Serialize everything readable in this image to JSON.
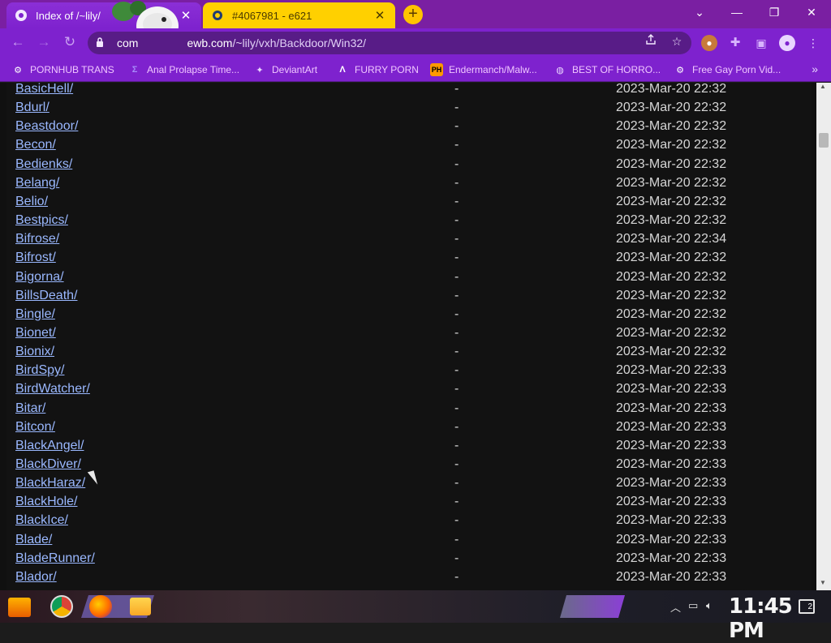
{
  "tabs": [
    {
      "title": "Index of /~lily/",
      "favicon": "app-icon",
      "active": true
    },
    {
      "title": "#4067981 - e621",
      "favicon": "e621-icon",
      "active": false
    }
  ],
  "close_glyph": "✕",
  "new_tab_glyph": "+",
  "window": {
    "minimize": "—",
    "maximize": "❐",
    "close": "✕",
    "dropdown": "⌄"
  },
  "nav": {
    "back": "←",
    "forward": "→",
    "reload": "↻"
  },
  "address": {
    "host_prefix": "com",
    "host_rest": "ewb.com",
    "path": "/~lily/vxh/Backdoor/Win32/"
  },
  "bookmarks": [
    {
      "label": "PORNHUB TRANS",
      "icon": "app-icon",
      "color": "#f0c6ff"
    },
    {
      "label": "Anal Prolapse Time...",
      "icon": "sigma-icon",
      "color": "#e5b0ff"
    },
    {
      "label": "DeviantArt",
      "icon": "da-icon",
      "color": "#e5b0ff"
    },
    {
      "label": "FURRY PORN",
      "icon": "lambda-icon",
      "color": "#e5b0ff"
    },
    {
      "label": "Endermanch/Malw...",
      "icon": "ph-icon",
      "color": "#e5b0ff"
    },
    {
      "label": "BEST OF HORRO...",
      "icon": "globe-icon",
      "color": "#e5b0ff"
    },
    {
      "label": "Free Gay Porn Vid...",
      "icon": "app-icon",
      "color": "#e5b0ff"
    }
  ],
  "bookmarks_more": "»",
  "listing": [
    {
      "name": "BasicHell/",
      "size": "-",
      "date": "2023-Mar-20 22:32"
    },
    {
      "name": "Bdurl/",
      "size": "-",
      "date": "2023-Mar-20 22:32"
    },
    {
      "name": "Beastdoor/",
      "size": "-",
      "date": "2023-Mar-20 22:32"
    },
    {
      "name": "Becon/",
      "size": "-",
      "date": "2023-Mar-20 22:32"
    },
    {
      "name": "Bedienks/",
      "size": "-",
      "date": "2023-Mar-20 22:32"
    },
    {
      "name": "Belang/",
      "size": "-",
      "date": "2023-Mar-20 22:32"
    },
    {
      "name": "Belio/",
      "size": "-",
      "date": "2023-Mar-20 22:32"
    },
    {
      "name": "Bestpics/",
      "size": "-",
      "date": "2023-Mar-20 22:32"
    },
    {
      "name": "Bifrose/",
      "size": "-",
      "date": "2023-Mar-20 22:34"
    },
    {
      "name": "Bifrost/",
      "size": "-",
      "date": "2023-Mar-20 22:32"
    },
    {
      "name": "Bigorna/",
      "size": "-",
      "date": "2023-Mar-20 22:32"
    },
    {
      "name": "BillsDeath/",
      "size": "-",
      "date": "2023-Mar-20 22:32"
    },
    {
      "name": "Bingle/",
      "size": "-",
      "date": "2023-Mar-20 22:32"
    },
    {
      "name": "Bionet/",
      "size": "-",
      "date": "2023-Mar-20 22:32"
    },
    {
      "name": "Bionix/",
      "size": "-",
      "date": "2023-Mar-20 22:32"
    },
    {
      "name": "BirdSpy/",
      "size": "-",
      "date": "2023-Mar-20 22:33"
    },
    {
      "name": "BirdWatcher/",
      "size": "-",
      "date": "2023-Mar-20 22:33"
    },
    {
      "name": "Bitar/",
      "size": "-",
      "date": "2023-Mar-20 22:33"
    },
    {
      "name": "Bitcon/",
      "size": "-",
      "date": "2023-Mar-20 22:33"
    },
    {
      "name": "BlackAngel/",
      "size": "-",
      "date": "2023-Mar-20 22:33"
    },
    {
      "name": "BlackDiver/",
      "size": "-",
      "date": "2023-Mar-20 22:33"
    },
    {
      "name": "BlackHaraz/",
      "size": "-",
      "date": "2023-Mar-20 22:33"
    },
    {
      "name": "BlackHole/",
      "size": "-",
      "date": "2023-Mar-20 22:33"
    },
    {
      "name": "BlackIce/",
      "size": "-",
      "date": "2023-Mar-20 22:33"
    },
    {
      "name": "Blade/",
      "size": "-",
      "date": "2023-Mar-20 22:33"
    },
    {
      "name": "BladeRunner/",
      "size": "-",
      "date": "2023-Mar-20 22:33"
    },
    {
      "name": "Blador/",
      "size": "-",
      "date": "2023-Mar-20 22:33"
    }
  ],
  "taskbar": {
    "clock": "11:45 PM",
    "notifications": "2"
  },
  "colors": {
    "tab_strip": "#7a1fa2",
    "toolbar": "#7e22ce",
    "inactive_tab": "#ffd000",
    "link": "#9ab8ff"
  }
}
